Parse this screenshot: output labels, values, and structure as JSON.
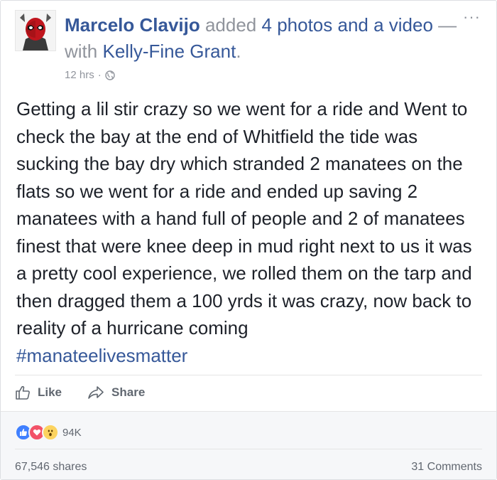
{
  "post": {
    "author": "Marcelo Clavijo",
    "action_word": "added",
    "action_object": "4 photos and a video",
    "with_prefix": "— with",
    "tagged_person": "Kelly-Fine Grant",
    "tag_suffix": ".",
    "timestamp": "12 hrs",
    "meta_separator": "·",
    "privacy_icon": "globe-icon",
    "more_label": "···",
    "body": "Getting a lil stir crazy so we went for a ride and Went to check the bay at the end of Whitfield the tide was sucking the bay dry which stranded 2 manatees on the flats so we went for a ride and ended up saving 2 manatees with a hand full of people and 2 of manatees finest that were knee deep in mud right next to us it was a pretty cool experience, we rolled them on the tarp and then dragged them a 100 yrds it was crazy, now back to reality of a hurricane coming",
    "hashtag": "#manateelivesmatter"
  },
  "actions": {
    "like_label": "Like",
    "share_label": "Share"
  },
  "footer": {
    "reaction_icons": [
      "like-reaction-icon",
      "love-reaction-icon",
      "wow-reaction-icon"
    ],
    "reaction_count": "94K",
    "shares": "67,546 shares",
    "comments": "31 Comments"
  },
  "colors": {
    "link": "#365899",
    "text": "#1d2129",
    "muted": "#90949c",
    "like_blue": "#4080ff",
    "love_red": "#f25268",
    "wow_yellow": "#fcd35f"
  }
}
